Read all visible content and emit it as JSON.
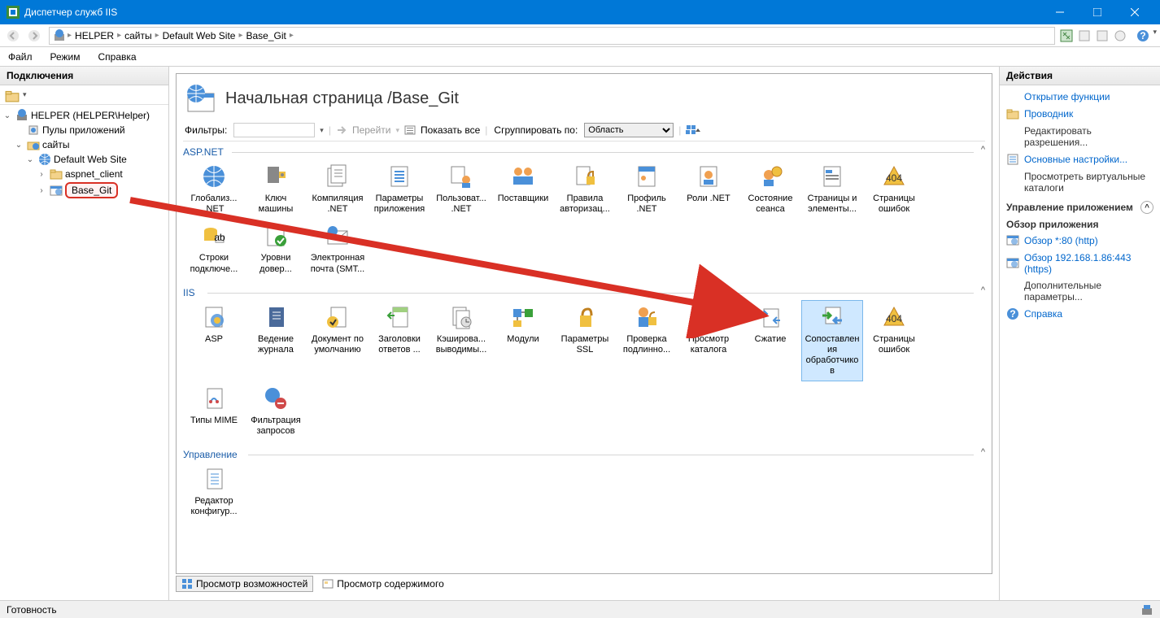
{
  "window": {
    "title": "Диспетчер служб IIS"
  },
  "breadcrumb": [
    "HELPER",
    "сайты",
    "Default Web Site",
    "Base_Git"
  ],
  "menu": {
    "file": "Файл",
    "mode": "Режим",
    "help": "Справка"
  },
  "connections": {
    "header": "Подключения",
    "tree": {
      "root": {
        "label": "HELPER (HELPER\\Helper)"
      },
      "pools": {
        "label": "Пулы приложений"
      },
      "sites": {
        "label": "сайты"
      },
      "dws": {
        "label": "Default Web Site"
      },
      "aspnet": {
        "label": "aspnet_client"
      },
      "basegit": {
        "label": "Base_Git"
      }
    }
  },
  "page": {
    "title": "Начальная страница /Base_Git"
  },
  "toolbar": {
    "filters": "Фильтры:",
    "go": "Перейти",
    "showall": "Показать все",
    "groupby": "Сгруппировать по:",
    "groupby_value": "Область"
  },
  "groups": {
    "aspnet": {
      "title": "ASP.NET",
      "items": [
        "Глобализ... .NET",
        "Ключ машины",
        "Компиляция .NET",
        "Параметры приложения",
        "Пользоват... .NET",
        "Поставщики",
        "Правила авторизац...",
        "Профиль .NET",
        "Роли .NET",
        "Состояние сеанса",
        "Страницы и элементы...",
        "Страницы ошибок",
        "Строки подключе...",
        "Уровни довер...",
        "Электронная почта (SMT..."
      ]
    },
    "iis": {
      "title": "IIS",
      "items": [
        "ASP",
        "Ведение журнала",
        "Документ по умолчанию",
        "Заголовки ответов ...",
        "Кэширова... выводимы...",
        "Модули",
        "Параметры SSL",
        "Проверка подлинно...",
        "Просмотр каталога",
        "Сжатие",
        "Сопоставления обработчиков",
        "Страницы ошибок",
        "Типы MIME",
        "Фильтрация запросов"
      ]
    },
    "mgmt": {
      "title": "Управление",
      "items": [
        "Редактор конфигур..."
      ]
    }
  },
  "bottomtabs": {
    "features": "Просмотр возможностей",
    "content": "Просмотр содержимого"
  },
  "actions": {
    "header": "Действия",
    "open": "Открытие функции",
    "explorer": "Проводник",
    "editperm": "Редактировать разрешения...",
    "basics": "Основные настройки...",
    "vdirs": "Просмотреть виртуальные каталоги",
    "appmgmt": "Управление приложением",
    "browse": "Обзор приложения",
    "b80": "Обзор *:80 (http)",
    "b443": "Обзор 192.168.1.86:443 (https)",
    "addl": "Дополнительные параметры...",
    "help": "Справка"
  },
  "status": {
    "ready": "Готовность"
  }
}
